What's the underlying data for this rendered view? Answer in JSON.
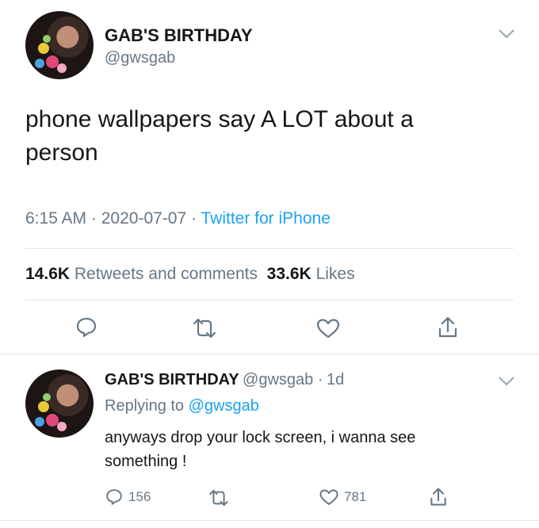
{
  "main_tweet": {
    "display_name": "GAB'S BIRTHDAY",
    "handle": "@gwsgab",
    "text_line1": "phone wallpapers say A LOT about a",
    "text_line2": "person",
    "time": "6:15 AM",
    "date": "2020-07-07",
    "separator": "·",
    "source": "Twitter for iPhone",
    "retweets_count": "14.6K",
    "retweets_label": "Retweets and comments",
    "likes_count": "33.6K",
    "likes_label": "Likes"
  },
  "reply_tweet": {
    "display_name": "GAB'S BIRTHDAY",
    "handle": "@gwsgab",
    "separator": "·",
    "age": "1d",
    "replying_prefix": "Replying to",
    "replying_to": "@gwsgab",
    "text_line1": "anyways drop your lock screen, i wanna see",
    "text_line2": "something !",
    "reply_count": "156",
    "like_count": "781"
  },
  "colors": {
    "accent": "#1da1f2",
    "muted": "#657786",
    "text": "#14171a",
    "divider": "#e1e8ed"
  },
  "icons": [
    "avatar",
    "chevron-down-icon",
    "reply-icon",
    "retweet-icon",
    "like-icon",
    "share-icon"
  ]
}
